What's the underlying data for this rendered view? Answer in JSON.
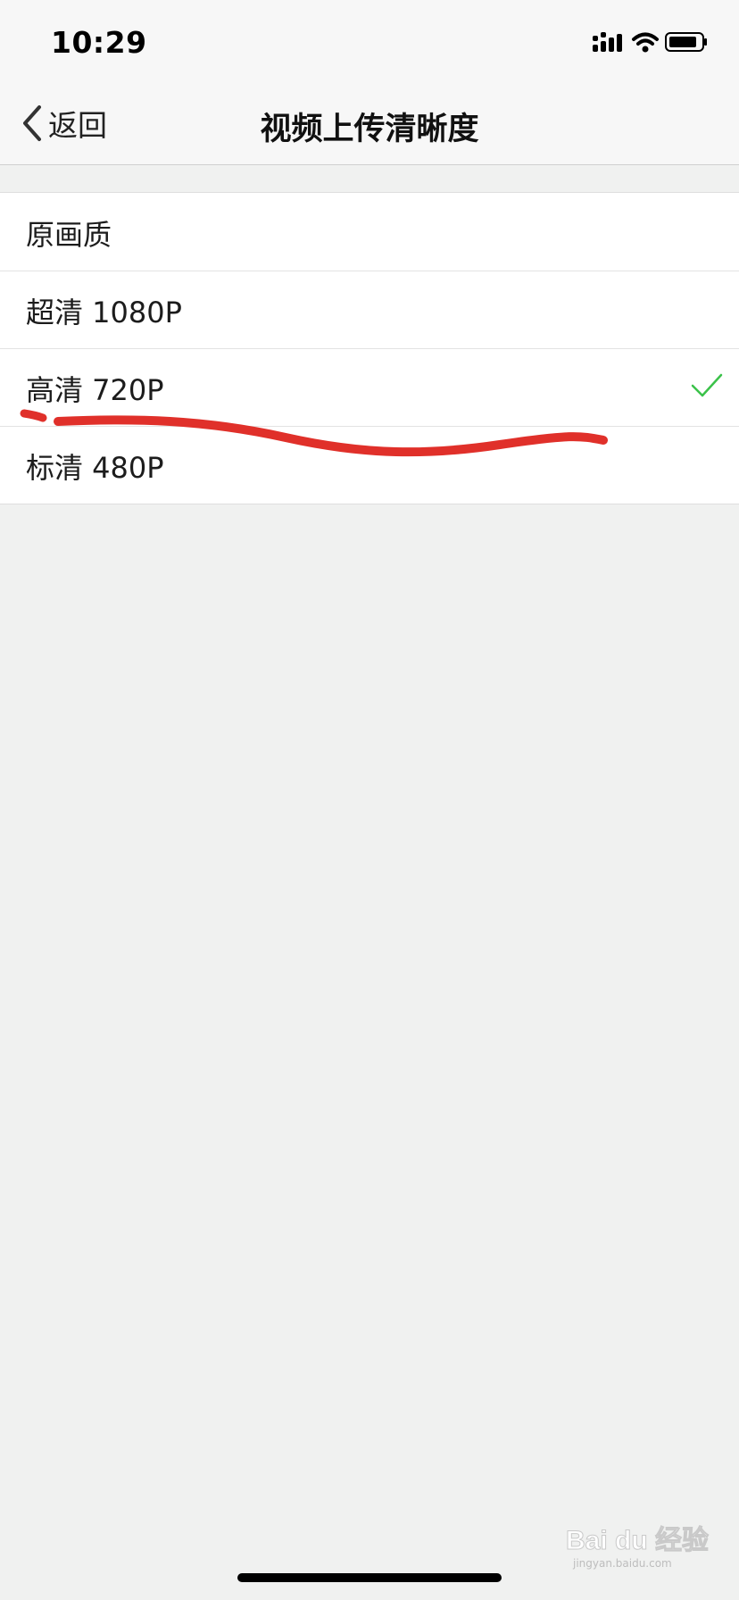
{
  "status_bar": {
    "time": "10:29",
    "icons": [
      "signal-icon",
      "wifi-icon",
      "battery-icon"
    ]
  },
  "nav": {
    "back_label": "返回",
    "title": "视频上传清晰度"
  },
  "options": [
    {
      "label": "原画质",
      "selected": false
    },
    {
      "label": "超清 1080P",
      "selected": false
    },
    {
      "label": "高清 720P",
      "selected": true
    },
    {
      "label": "标清 480P",
      "selected": false
    }
  ],
  "colors": {
    "check": "#3bc24a",
    "annotation": "#e0302a",
    "background": "#f0f1f0"
  },
  "watermark": {
    "brand": "Bai du 经验",
    "sub": "jingyan.baidu.com"
  }
}
